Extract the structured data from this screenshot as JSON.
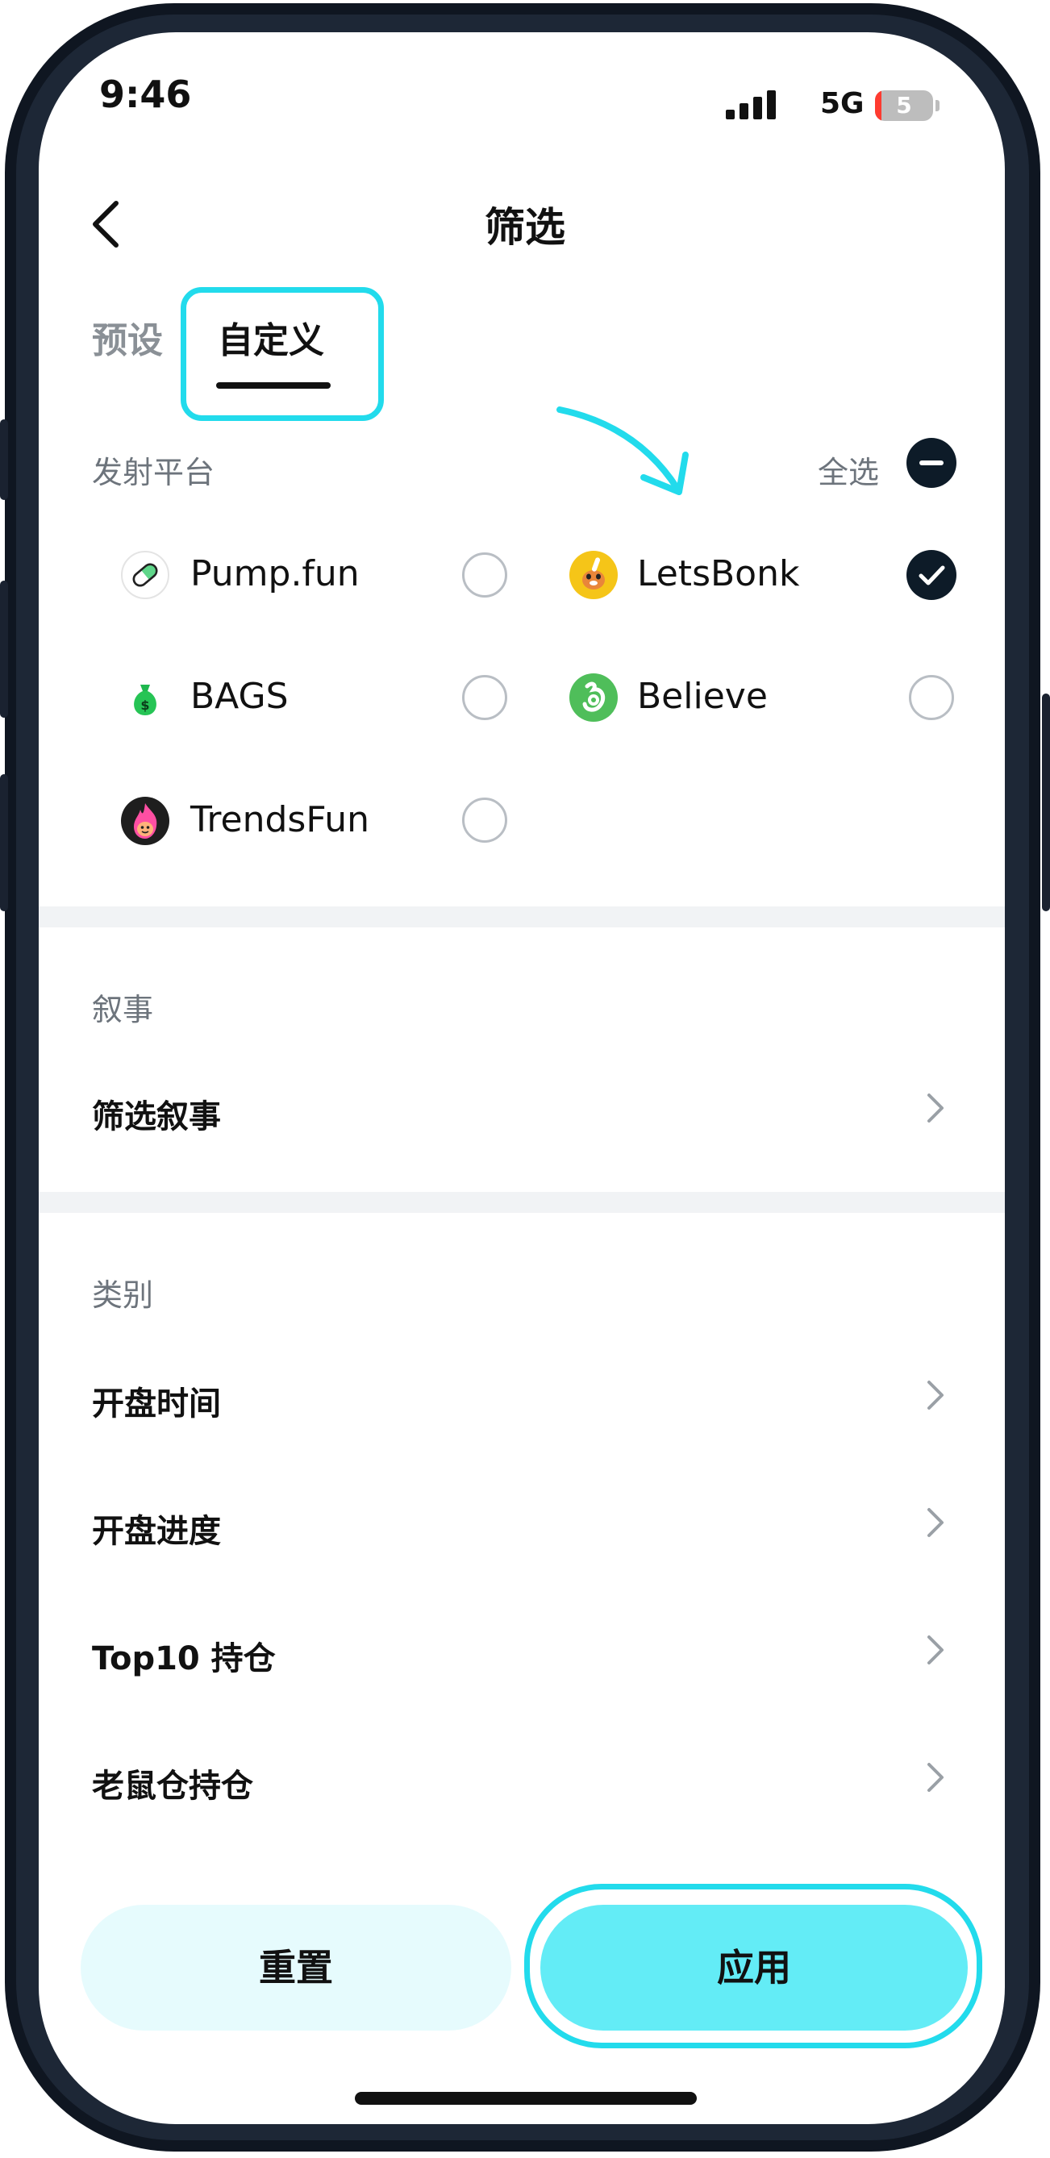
{
  "status_bar": {
    "time": "9:46",
    "network": "5G",
    "battery": "5"
  },
  "header": {
    "title": "筛选"
  },
  "tabs": [
    {
      "label": "预设",
      "active": false
    },
    {
      "label": "自定义",
      "active": true
    }
  ],
  "platform_section": {
    "label": "发射平台",
    "select_all_label": "全选",
    "platforms": [
      {
        "name": "Pump.fun",
        "selected": false,
        "icon": "pill-icon"
      },
      {
        "name": "LetsBonk",
        "selected": true,
        "icon": "bonk-dog-icon"
      },
      {
        "name": "BAGS",
        "selected": false,
        "icon": "money-bag-icon"
      },
      {
        "name": "Believe",
        "selected": false,
        "icon": "believe-icon"
      },
      {
        "name": "TrendsFun",
        "selected": false,
        "icon": "flame-icon"
      }
    ]
  },
  "narrative_section": {
    "label": "叙事",
    "items": [
      {
        "label": "筛选叙事"
      }
    ]
  },
  "category_section": {
    "label": "类别",
    "items": [
      {
        "label": "开盘时间"
      },
      {
        "label": "开盘进度"
      },
      {
        "label": "Top10 持仓"
      },
      {
        "label": "老鼠仓持仓"
      }
    ]
  },
  "actions": {
    "reset_label": "重置",
    "apply_label": "应用"
  },
  "colors": {
    "highlight": "#22dbec",
    "apply_button": "#63ecf6",
    "reset_button": "#e6fbfd",
    "selected_fill": "#0d1b28"
  }
}
